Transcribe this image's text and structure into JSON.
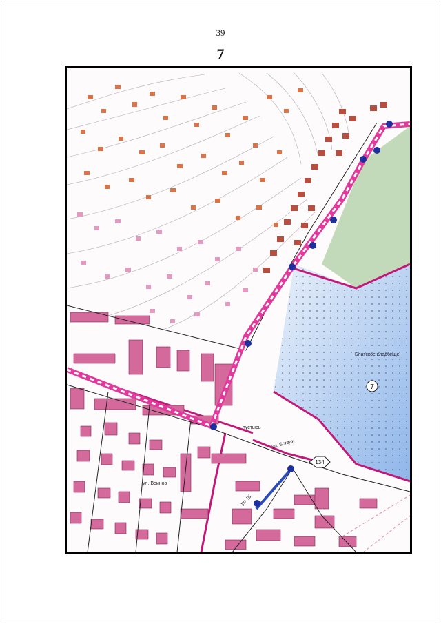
{
  "page": {
    "number": "39",
    "sheet": "7"
  },
  "map": {
    "labels": {
      "cemetery": "Блатское кладбище",
      "wasteland": "пустырь",
      "street_bogdan": "ул. Богдан",
      "street_voinov": "ул. Воинов",
      "street_sh": "ул. Ш"
    },
    "markers": {
      "circle_7": "7",
      "hex_134": "134"
    },
    "colors": {
      "boundary_magenta": "#c2187a",
      "route_pink": "#e13a9c",
      "node_blue": "#1f2f9e",
      "building_pink": "#d46a9c",
      "house_orange": "#d8744a",
      "cemetery_blue": "#a9c8ec",
      "park_green": "#b7d2ae"
    }
  }
}
